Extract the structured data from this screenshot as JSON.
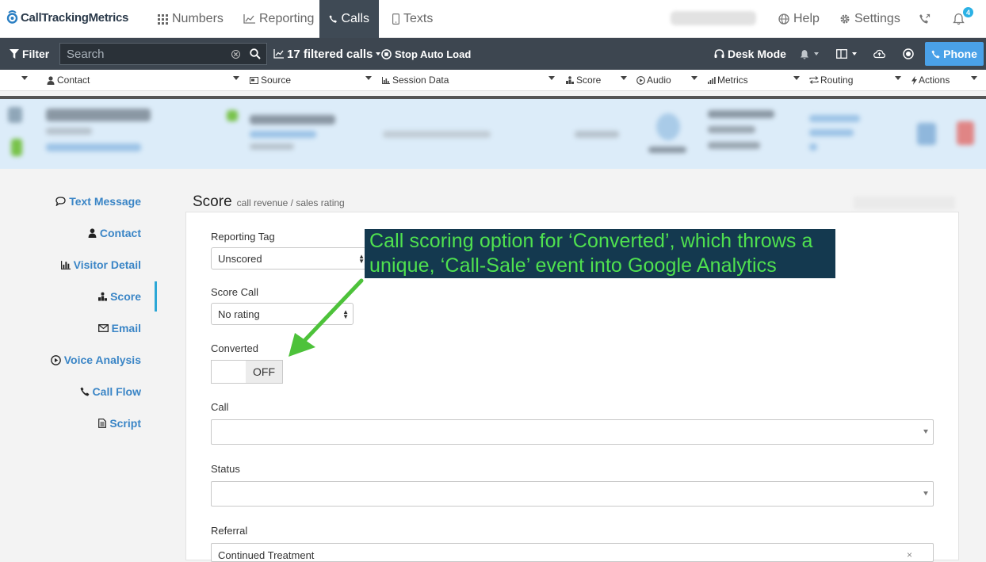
{
  "app": {
    "name": "CallTrackingMetrics"
  },
  "topnav": {
    "items": [
      {
        "label": "Numbers",
        "icon": "grid-icon"
      },
      {
        "label": "Reporting",
        "icon": "chart-icon"
      },
      {
        "label": "Calls",
        "icon": "phone-icon",
        "active": true
      },
      {
        "label": "Texts",
        "icon": "mobile-icon"
      }
    ],
    "help_label": "Help",
    "settings_label": "Settings",
    "notification_count": "4"
  },
  "filterbar": {
    "filter_label": "Filter",
    "search_placeholder": "Search",
    "filtered_calls_label": "17 filtered calls",
    "stop_auto_load_label": "Stop Auto Load",
    "desk_mode_label": "Desk Mode",
    "phone_label": "Phone"
  },
  "columns": [
    "Contact",
    "Source",
    "Session Data",
    "Score",
    "Audio",
    "Metrics",
    "Routing",
    "Actions"
  ],
  "side_menu": [
    {
      "label": "Text Message",
      "icon": "speech-bubble-icon"
    },
    {
      "label": "Contact",
      "icon": "user-icon"
    },
    {
      "label": "Visitor Detail",
      "icon": "bar-chart-icon"
    },
    {
      "label": "Score",
      "icon": "podium-icon",
      "active": true
    },
    {
      "label": "Email",
      "icon": "envelope-icon"
    },
    {
      "label": "Voice Analysis",
      "icon": "play-circle-icon"
    },
    {
      "label": "Call Flow",
      "icon": "phone-icon"
    },
    {
      "label": "Script",
      "icon": "document-icon"
    }
  ],
  "section": {
    "title": "Score",
    "subtitle": "call revenue / sales rating"
  },
  "form": {
    "reporting_tag_label": "Reporting Tag",
    "reporting_tag_value": "Unscored",
    "score_call_label": "Score Call",
    "score_call_value": "No rating",
    "converted_label": "Converted",
    "converted_toggle": "OFF",
    "call_label": "Call",
    "status_label": "Status",
    "referral_label": "Referral",
    "referral_value": "Continued Treatment"
  },
  "annotation": {
    "text": "Call scoring option for ‘Converted’, which throws a unique, ‘Call-Sale’ event into Google Analytics",
    "text_color": "#4fe14f",
    "background": "#14394f",
    "arrow_color": "#4dc23a"
  },
  "colors": {
    "accent": "#3a85c6",
    "nav_dark": "#3d4650",
    "phone_button": "#4aa1e8",
    "selected_row": "#dcecf9"
  }
}
